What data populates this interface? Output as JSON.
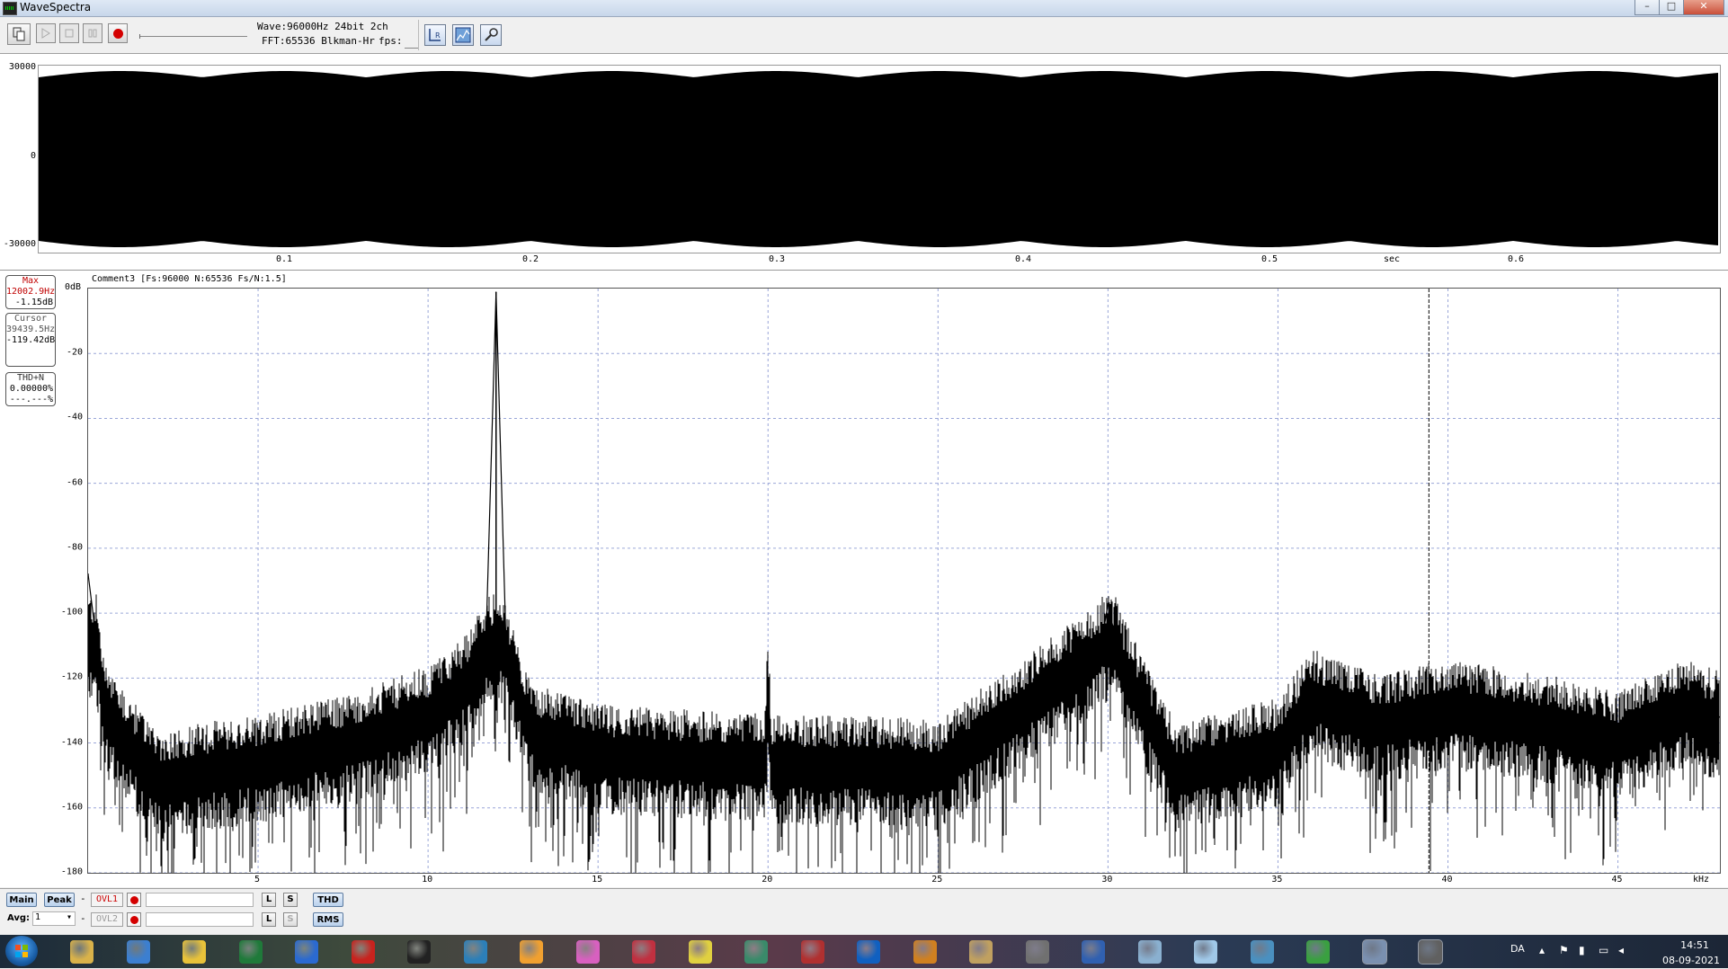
{
  "window": {
    "title": "WaveSpectra",
    "minimize": "–",
    "maximize": "□",
    "close": "✕"
  },
  "toolbar": {
    "wave_info": "Wave:96000Hz 24bit 2ch",
    "fft_info": "FFT:65536 Blkman-Hr",
    "fps_label": "fps:"
  },
  "waveform": {
    "y_labels": [
      "30000",
      "0",
      "-30000"
    ],
    "x_labels": [
      "0.1",
      "0.2",
      "0.3",
      "0.4",
      "0.5",
      "0.6"
    ],
    "x_unit": "sec"
  },
  "spectrum": {
    "header": "Comment3  [Fs:96000 N:65536 Fs/N:1.5]",
    "y_unit_label": "0dB",
    "y_labels": [
      "-20",
      "-40",
      "-60",
      "-80",
      "-100",
      "-120",
      "-140",
      "-160",
      "-180"
    ],
    "x_labels": [
      "5",
      "10",
      "15",
      "20",
      "25",
      "30",
      "35",
      "40",
      "45"
    ],
    "x_unit": "kHz",
    "cursor_khz": 39.44
  },
  "readouts": {
    "max": {
      "title": "Max",
      "freq": "12002.9Hz",
      "level": "-1.15dB"
    },
    "cursor": {
      "title": "Cursor",
      "freq": "39439.5Hz",
      "level": "-119.42dB"
    },
    "thd": {
      "title": "THD+N",
      "value1": "0.00000%",
      "value2": "---.---%"
    }
  },
  "controls": {
    "main": "Main",
    "peak": "Peak",
    "dash": "-",
    "ovl1": "OVL1",
    "ovl2": "OVL2",
    "l": "L",
    "s": "S",
    "thd": "THD",
    "rms": "RMS",
    "avg_label": "Avg:",
    "avg_value": "1",
    "avg_arrow": "▾"
  },
  "chart_data": {
    "type": "line",
    "title": "",
    "xlabel": "kHz",
    "ylabel": "dB",
    "xlim": [
      0,
      48
    ],
    "ylim": [
      -180,
      0
    ],
    "grid": true,
    "series": [
      {
        "x": [
          0,
          0.5,
          2,
          5,
          8,
          10,
          11,
          11.7,
          12.0,
          12.3,
          13,
          15,
          19.9,
          20,
          20.1,
          24,
          25,
          29.8,
          30.0,
          30.3,
          32,
          35,
          36.0,
          38,
          40,
          43,
          45,
          47,
          48
        ],
        "y": [
          -88,
          -130,
          -150,
          -145,
          -138,
          -130,
          -122,
          -110,
          -1.15,
          -112,
          -135,
          -142,
          -145,
          -120,
          -145,
          -146,
          -147,
          -110,
          -97,
          -112,
          -148,
          -140,
          -125,
          -133,
          -128,
          -133,
          -138,
          -128,
          -132
        ]
      }
    ]
  },
  "taskbar": {
    "lang": "DA",
    "time": "14:51",
    "date": "08-09-2021",
    "icons": [
      "explorer-icon",
      "outlook-icon",
      "chrome-icon",
      "excel-icon",
      "word-icon",
      "acrobat-icon",
      "app-circle-icon",
      "feather-icon",
      "flower-icon",
      "orchid-icon",
      "tool-icon",
      "bulb-icon",
      "terminal-icon",
      "antenna-icon",
      "player-icon",
      "color-icon",
      "schematic-icon",
      "coil-icon",
      "e-icon",
      "calculator-icon",
      "note-icon",
      "screen-icon",
      "green-app-icon",
      "network-icon",
      "wavespectra-icon"
    ],
    "icon_colors": [
      "#d9b24a",
      "#3c7fd0",
      "#e8c23a",
      "#1f7a3a",
      "#2b6ad0",
      "#c8231e",
      "#222222",
      "#2c7fb8",
      "#f0a030",
      "#d860c0",
      "#c03040",
      "#e0d040",
      "#3a8a6a",
      "#b03030",
      "#1060c0",
      "#d08020",
      "#c0a060",
      "#707070",
      "#3060b0",
      "#8ab0d0",
      "#a0c8e8",
      "#4a90c0",
      "#3aa040",
      "#7a90b0",
      "#606060"
    ]
  }
}
